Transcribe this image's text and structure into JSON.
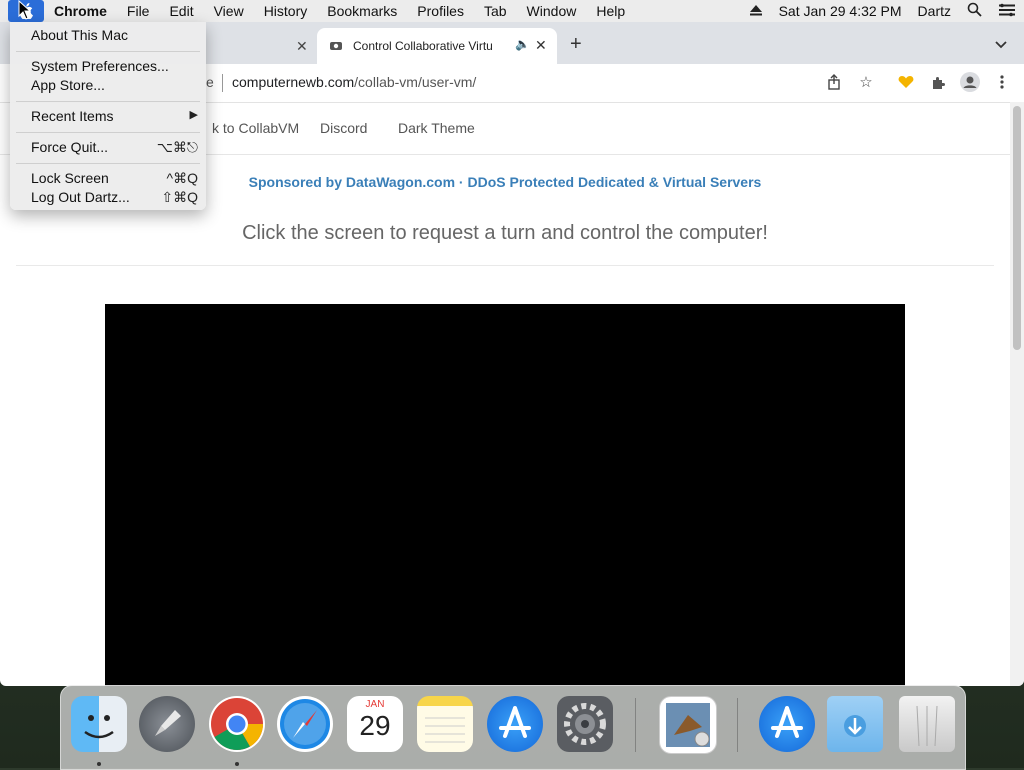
{
  "menubar": {
    "app_name": "Chrome",
    "items": [
      "File",
      "Edit",
      "View",
      "History",
      "Bookmarks",
      "Profiles",
      "Tab",
      "Window",
      "Help"
    ],
    "datetime": "Sat Jan 29  4:32 PM",
    "user": "Dartz"
  },
  "apple_menu": {
    "about": "About This Mac",
    "system_prefs": "System Preferences...",
    "app_store": "App Store...",
    "recent_items": "Recent Items",
    "force_quit": "Force Quit...",
    "force_quit_shortcut": "⌥⌘⎋",
    "lock_screen": "Lock Screen",
    "lock_screen_shortcut": "^⌘Q",
    "log_out": "Log Out Dartz...",
    "log_out_shortcut": "⇧⌘Q"
  },
  "tabs": {
    "active_title": "Control Collaborative Virtu",
    "audio_icon": "speaker-icon"
  },
  "toolbar": {
    "omnibox_tail": "e",
    "url_host": "computernewb.com",
    "url_path": "/collab-vm/user-vm/"
  },
  "site": {
    "nav": [
      "k to CollabVM",
      "Discord",
      "Dark Theme"
    ],
    "sponsor": "Sponsored by DataWagon.com · DDoS Protected Dedicated & Virtual Servers",
    "instruction": "Click the screen to request a turn and control the computer!"
  },
  "dock": {
    "apps": [
      "Finder",
      "Launchpad",
      "Google Chrome",
      "Safari",
      "Calendar",
      "Notes",
      "App Store",
      "System Preferences",
      "Mail Preview",
      "App Store Downloads",
      "Downloads",
      "Trash"
    ],
    "calendar_month": "JAN",
    "calendar_day": "29"
  },
  "colors": {
    "menubar_bg": "#ececec",
    "apple_highlight": "#2b6dd8",
    "sponsor_link": "#3a7fb8",
    "vm_screen": "#000000",
    "extension_heart": "#f4b400"
  }
}
